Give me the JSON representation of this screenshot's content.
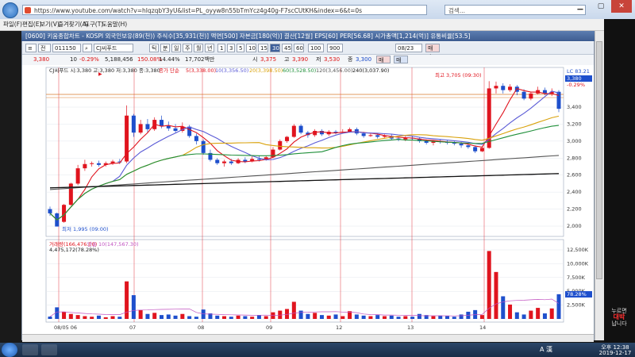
{
  "browser": {
    "url": "https://www.youtube.com/watch?v=hIqzqbY3yU&list=PL_oyyw8n55bTmYcz4g40g-F7scCUtKH&index=6&t=0s",
    "search_placeholder": "검색...",
    "menu": [
      "파일(F)",
      "편집(E)",
      "보기(V)",
      "즐겨찾기(A)",
      "도구(T)",
      "도움말(H)"
    ]
  },
  "app": {
    "title": "[0600] 키움종합차트 - KOSPI 외국인보유(89(천)) 주식수[35,931(천)] 액면[500] 자본금[180(억)] 결산[12월] EPS[60] PER[56.68] 시가총액[1,214(억)] 유통비율[53.5]",
    "toolbar1": {
      "code": "011150",
      "name": "CJ씨푸드",
      "periods": [
        "틱",
        "분",
        "일",
        "주",
        "월",
        "년"
      ],
      "minutes": [
        "1",
        "3",
        "5",
        "10",
        "15",
        "30",
        "45",
        "60"
      ],
      "active_period": "30",
      "count": "100",
      "range": "900",
      "date": "08/23",
      "buy_label": "매수",
      "sell_label": "매도"
    },
    "toolbar2": {
      "price": "3,380",
      "change_count": "10",
      "change_pct": "-0.29%",
      "volume": "5,188,456",
      "vol_ratio": "150.08%",
      "turnover": "14.44%",
      "amount": "17,702백만",
      "open_label": "시",
      "open": "3,375",
      "high_label": "고",
      "high": "3,390",
      "low_label": "저",
      "low": "3,530",
      "close_label": "종",
      "close": "3,300"
    },
    "legend": {
      "series_label": "CJ씨푸드 시:3,380 고:3,380 저:3,380 종:3,380",
      "ma_label": "종가 단순",
      "ma5": "5(3,338.00)",
      "ma10": "10(3,356.50)",
      "ma20": "20(3,398.50)",
      "ma60": "60(3,528.50)",
      "ma120": "120(3,456.00)",
      "ma240": "240(3,037.90)"
    },
    "price_axis": [
      "3,400",
      "3,200",
      "3,000",
      "2,800",
      "2,600",
      "2,400",
      "2,200",
      "2,000"
    ],
    "price_current": "3,380",
    "price_current_pct": "-0.29%",
    "price_top_label": "LC 83.21",
    "high_annotation": "최고 3,705 (09:30)",
    "low_annotation": "최저 1,995 (09:00)",
    "volume_legend": "거래량(166,476.00)",
    "volume_ma_label": "단순 10(147,567.30)",
    "volume_info": "4,475,172(78.28%)",
    "volume_axis": [
      "12,500K",
      "10,000K",
      "7,500K",
      "5,000K",
      "2,500K",
      "0"
    ],
    "volume_current": "78.28%",
    "date_labels": [
      "08/05 06",
      "07",
      "08",
      "09",
      "12",
      "13",
      "14"
    ],
    "colors": {
      "up": "#e0141e",
      "down": "#1e4fcc",
      "ma5": "#e0141e",
      "ma10": "#5b5bd6",
      "ma20": "#d9a20c",
      "ma60": "#1f8f3a",
      "ma120": "#555555",
      "ma240": "#111111"
    }
  },
  "watermark": {
    "line1": "누르면",
    "line2": "대박",
    "line3": "납니다"
  },
  "taskbar": {
    "ime": "A 漢",
    "time": "오후 12:38",
    "date": "2019-12-17"
  }
}
